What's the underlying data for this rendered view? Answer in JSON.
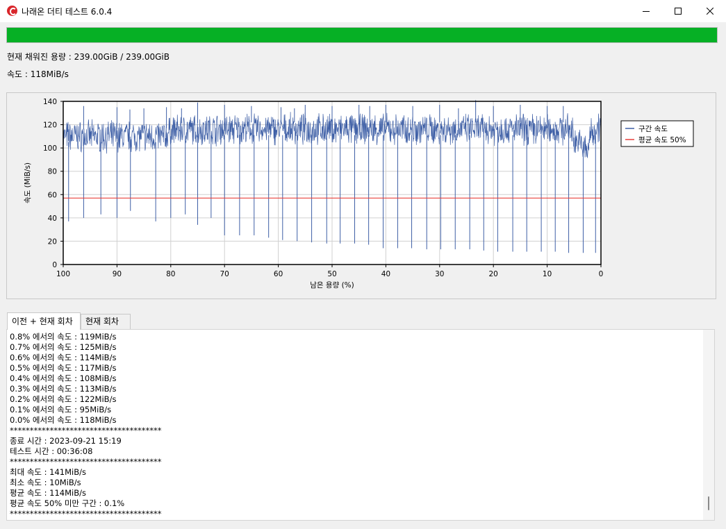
{
  "window": {
    "title": "나래온 더티 테스트 6.0.4",
    "icon": "app-logo-icon"
  },
  "progress": {
    "fraction": 1.0,
    "color": "#06b025"
  },
  "info": {
    "filled_label": "현재 채워진 용량 : 239.00GiB / 239.00GiB",
    "speed_label": "속도 : 118MiB/s"
  },
  "chart_data": {
    "type": "line",
    "xlabel": "남은 용량 (%)",
    "ylabel": "속도 (MiB/s)",
    "xlim": [
      100,
      0
    ],
    "ylim": [
      0,
      140
    ],
    "x_ticks": [
      100,
      90,
      80,
      70,
      60,
      50,
      40,
      30,
      20,
      10,
      0
    ],
    "y_ticks": [
      0,
      20,
      40,
      60,
      80,
      100,
      120,
      140
    ],
    "grid": true,
    "legend_placement": "right",
    "series": [
      {
        "name": "구간 속도",
        "color": "#3e5fa6",
        "band_mean": [
          [
            100,
            110
          ],
          [
            90,
            110
          ],
          [
            81,
            110
          ],
          [
            80,
            115
          ],
          [
            70,
            116
          ],
          [
            60,
            116
          ],
          [
            50,
            116
          ],
          [
            40,
            116
          ],
          [
            30,
            116
          ],
          [
            20,
            116
          ],
          [
            10,
            116
          ],
          [
            5.5,
            116
          ],
          [
            5,
            108
          ],
          [
            3,
            100
          ],
          [
            2.5,
            95
          ],
          [
            2,
            112
          ],
          [
            0,
            120
          ]
        ],
        "dips": [
          [
            99,
            37
          ],
          [
            96.2,
            40
          ],
          [
            93,
            43
          ],
          [
            90,
            40
          ],
          [
            87.5,
            46
          ],
          [
            82.8,
            37
          ],
          [
            80,
            40
          ],
          [
            77.3,
            43
          ],
          [
            75,
            34
          ],
          [
            72.5,
            40
          ],
          [
            70,
            25
          ],
          [
            67.2,
            25
          ],
          [
            64.5,
            25
          ],
          [
            61.8,
            23
          ],
          [
            59.2,
            21
          ],
          [
            56.5,
            20
          ],
          [
            53.8,
            19
          ],
          [
            51,
            18
          ],
          [
            48.5,
            18
          ],
          [
            45.8,
            18
          ],
          [
            43.2,
            17
          ],
          [
            40.5,
            14
          ],
          [
            37.8,
            14
          ],
          [
            35.2,
            14
          ],
          [
            32.4,
            13
          ],
          [
            29.8,
            13
          ],
          [
            27.1,
            13
          ],
          [
            24.4,
            13
          ],
          [
            21.8,
            12
          ],
          [
            19.2,
            11
          ],
          [
            16.4,
            11
          ],
          [
            13.8,
            11
          ],
          [
            11.1,
            11
          ],
          [
            8.5,
            11
          ],
          [
            6,
            10
          ],
          [
            3.3,
            10
          ],
          [
            1,
            10
          ]
        ],
        "spikes": [
          [
            96.2,
            136
          ],
          [
            90,
            135
          ],
          [
            87.6,
            133
          ],
          [
            85,
            134
          ],
          [
            80.8,
            135
          ],
          [
            78,
            134
          ],
          [
            75,
            139
          ],
          [
            70,
            137
          ],
          [
            65,
            136
          ],
          [
            59.5,
            135
          ],
          [
            57,
            134
          ],
          [
            55,
            137
          ],
          [
            50,
            136
          ],
          [
            45,
            137
          ],
          [
            43,
            136
          ],
          [
            40,
            137
          ],
          [
            35,
            136
          ],
          [
            30,
            137
          ],
          [
            26.5,
            134
          ],
          [
            23.3,
            141
          ],
          [
            20,
            136
          ],
          [
            15,
            137
          ],
          [
            10,
            136
          ],
          [
            7,
            136
          ]
        ]
      },
      {
        "name": "평균 속도 50%",
        "color": "#e8403c",
        "value": 57
      }
    ]
  },
  "tabs": [
    {
      "label": "이전 + 현재 회차",
      "active": true
    },
    {
      "label": "현재 회차",
      "active": false
    }
  ],
  "log": [
    "0.8% 에서의 속도 : 119MiB/s",
    "0.7% 에서의 속도 : 125MiB/s",
    "0.6% 에서의 속도 : 114MiB/s",
    "0.5% 에서의 속도 : 117MiB/s",
    "0.4% 에서의 속도 : 108MiB/s",
    "0.3% 에서의 속도 : 113MiB/s",
    "0.2% 에서의 속도 : 122MiB/s",
    "0.1% 에서의 속도 : 95MiB/s",
    "0.0% 에서의 속도 : 118MiB/s",
    "**************************************",
    "종료 시간 : 2023-09-21 15:19",
    "테스트 시간 : 00:36:08",
    "**************************************",
    "최대 속도 : 141MiB/s",
    "최소 속도 : 10MiB/s",
    "평균 속도 : 114MiB/s",
    "평균 속도 50% 미만 구간 : 0.1%",
    "**************************************"
  ]
}
